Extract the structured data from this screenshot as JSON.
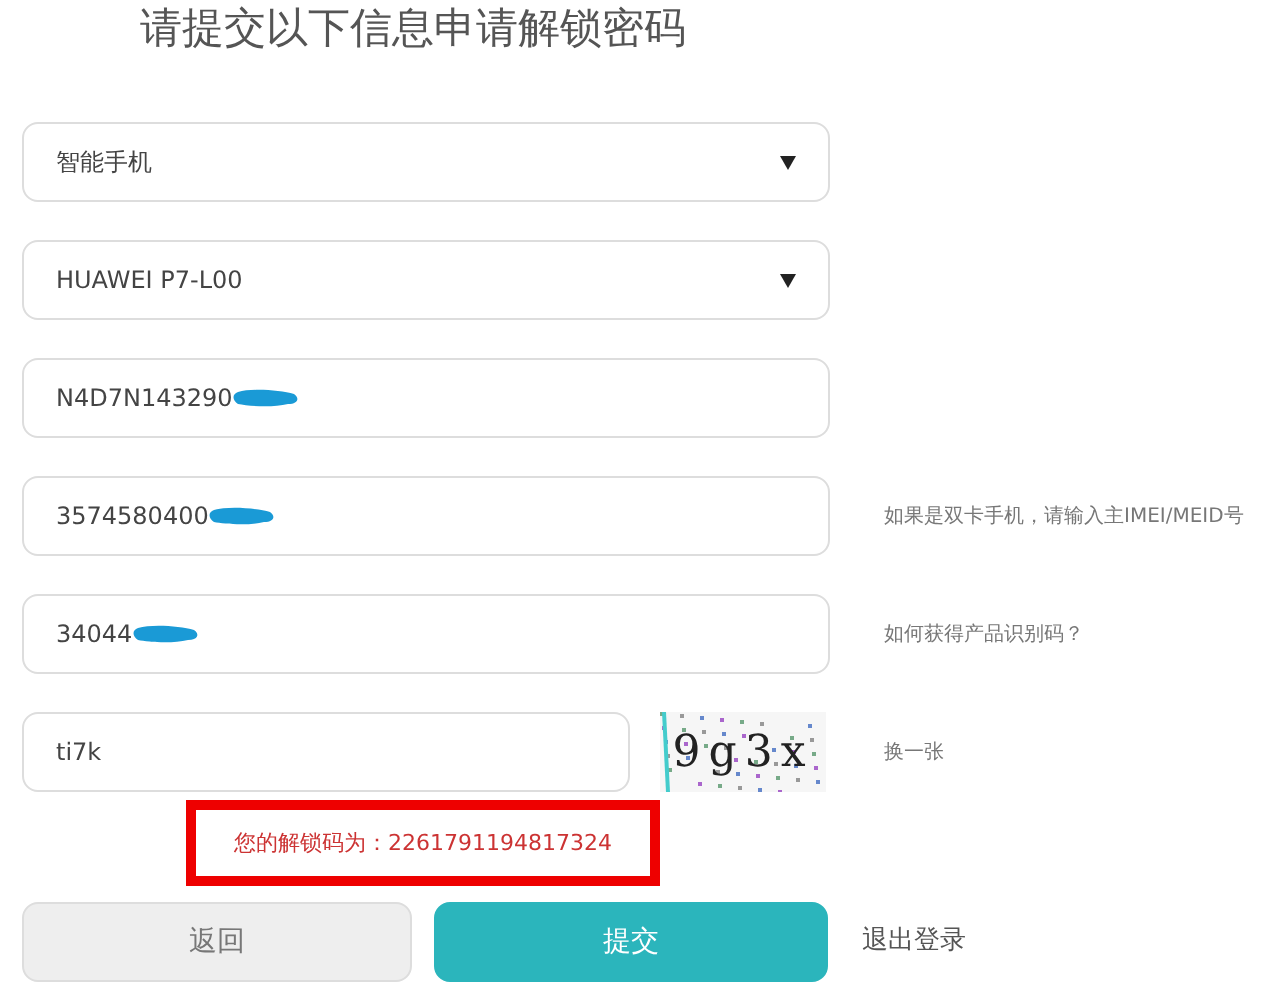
{
  "title": "请提交以下信息申请解锁密码",
  "fields": [
    {
      "kind": "select",
      "value": "智能手机"
    },
    {
      "kind": "select",
      "value": "HUAWEI P7-L00"
    },
    {
      "kind": "input",
      "value": "N4D7N143290",
      "redacted": true
    },
    {
      "kind": "input",
      "value": "3574580400",
      "redacted": true,
      "hint": "如果是双卡手机，请输入主IMEI/MEID号"
    },
    {
      "kind": "input",
      "value": "34044",
      "redacted": true,
      "hint": "如何获得产品识别码？"
    },
    {
      "kind": "captcha",
      "value": "ti7k",
      "captcha_text": "9g3x",
      "hint": "换一张"
    }
  ],
  "result": "您的解锁码为：2261791194817324",
  "buttons": [
    {
      "label": "返回",
      "kind": "secondary"
    },
    {
      "label": "提交",
      "kind": "primary"
    }
  ],
  "logout": "退出登录"
}
